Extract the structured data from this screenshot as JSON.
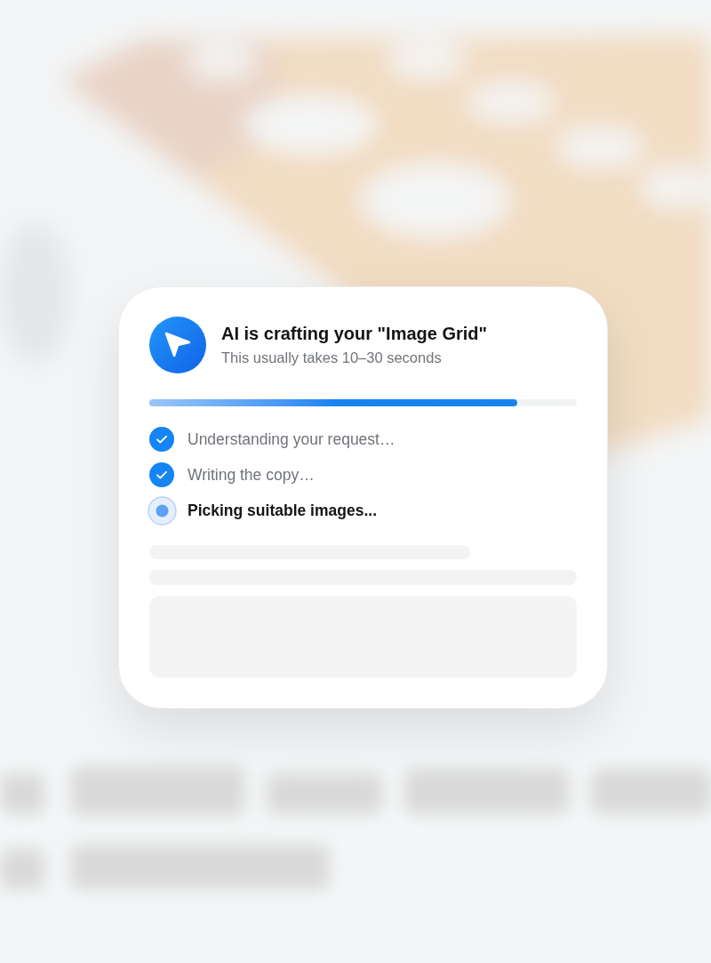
{
  "header": {
    "title": "AI is crafting your \"Image Grid\"",
    "subtitle": "This usually takes 10–30 seconds"
  },
  "progress": {
    "level": 0.86
  },
  "steps": [
    {
      "label": "Understanding your request…",
      "done": true
    },
    {
      "label": "Writing the copy…",
      "done": true
    },
    {
      "label": "Picking suitable images...",
      "done": false
    }
  ]
}
